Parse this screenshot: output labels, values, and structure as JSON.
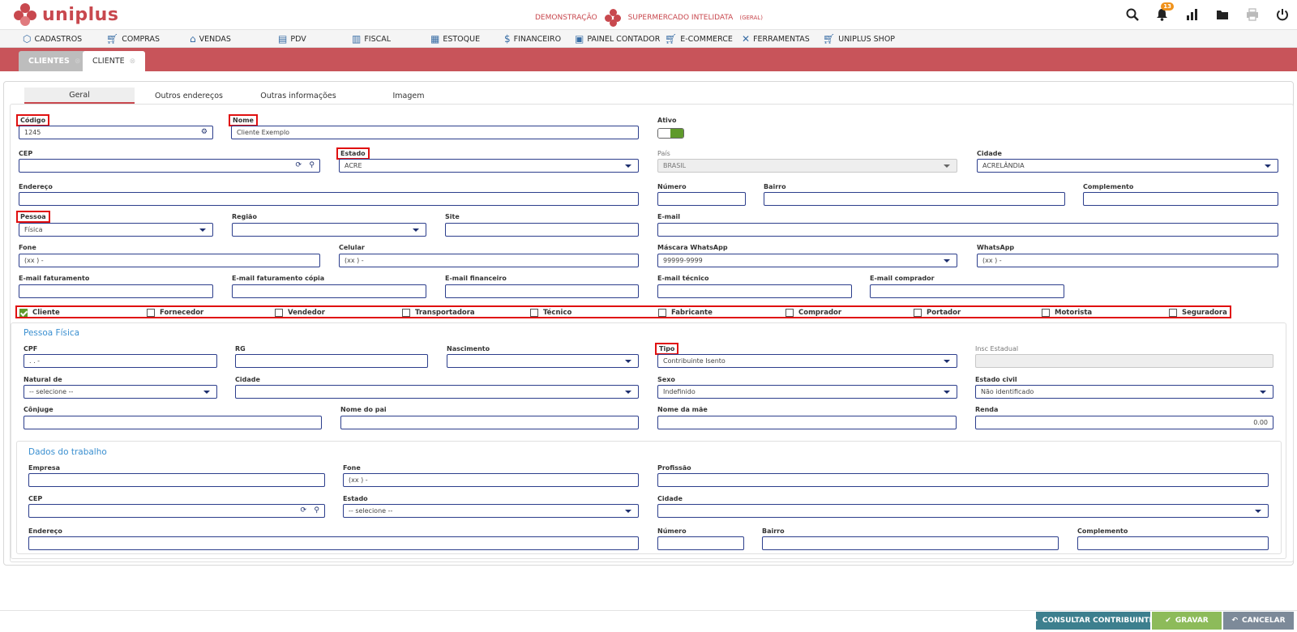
{
  "header": {
    "logo_text": "uniplus",
    "demo_label": "DEMONSTRAÇÃO",
    "company_name": "SUPERMERCADO INTELIDATA",
    "company_group": "(GERAL)",
    "notification_count": "13",
    "brand_color": "#c8484e",
    "icons": [
      "search-icon",
      "bell-icon",
      "chart-icon",
      "folder-icon",
      "printer-icon",
      "power-icon"
    ]
  },
  "menu": [
    {
      "label": "CADASTROS",
      "icon": "cube-icon"
    },
    {
      "label": "COMPRAS",
      "icon": "cart-icon"
    },
    {
      "label": "VENDAS",
      "icon": "tag-icon"
    },
    {
      "label": "PDV",
      "icon": "pos-icon"
    },
    {
      "label": "FISCAL",
      "icon": "document-icon"
    },
    {
      "label": "ESTOQUE",
      "icon": "box-icon"
    },
    {
      "label": "FINANCEIRO",
      "icon": "money-icon"
    },
    {
      "label": "PAINEL CONTADOR",
      "icon": "panel-icon"
    },
    {
      "label": "E-COMMERCE",
      "icon": "cart-icon"
    },
    {
      "label": "FERRAMENTAS",
      "icon": "tools-icon"
    },
    {
      "label": "UNIPLUS SHOP",
      "icon": "cart-icon"
    }
  ],
  "page_tabs": [
    {
      "label": "CLIENTES",
      "active": false
    },
    {
      "label": "CLIENTE",
      "active": true
    }
  ],
  "subtabs": [
    "Geral",
    "Outros endereços",
    "Outras informações",
    "Imagem"
  ],
  "general": {
    "codigo": {
      "label": "Código",
      "value": "1245"
    },
    "nome": {
      "label": "Nome",
      "value": "Cliente Exemplo"
    },
    "ativo": {
      "label": "Ativo",
      "value": true
    },
    "cep": {
      "label": "CEP",
      "value": ""
    },
    "estado": {
      "label": "Estado",
      "value": "ACRE"
    },
    "pais": {
      "label": "País",
      "value": "BRASIL"
    },
    "cidade": {
      "label": "Cidade",
      "value": "ACRELÂNDIA"
    },
    "endereco": {
      "label": "Endereço",
      "value": ""
    },
    "numero": {
      "label": "Número",
      "value": ""
    },
    "bairro": {
      "label": "Bairro",
      "value": ""
    },
    "complemento": {
      "label": "Complemento",
      "value": ""
    },
    "pessoa": {
      "label": "Pessoa",
      "value": "Física"
    },
    "regiao": {
      "label": "Região",
      "value": ""
    },
    "site": {
      "label": "Site",
      "value": ""
    },
    "email": {
      "label": "E-mail",
      "value": ""
    },
    "fone": {
      "label": "Fone",
      "value": "(xx )    -"
    },
    "celular": {
      "label": "Celular",
      "value": "(xx )    -"
    },
    "mascara_whatsapp": {
      "label": "Máscara WhatsApp",
      "value": "99999-9999"
    },
    "whatsapp": {
      "label": "WhatsApp",
      "value": "(xx )    -"
    },
    "email_faturamento": {
      "label": "E-mail faturamento",
      "value": ""
    },
    "email_faturamento_copia": {
      "label": "E-mail faturamento cópia",
      "value": ""
    },
    "email_financeiro": {
      "label": "E-mail financeiro",
      "value": ""
    },
    "email_tecnico": {
      "label": "E-mail técnico",
      "value": ""
    },
    "email_comprador": {
      "label": "E-mail comprador",
      "value": ""
    }
  },
  "roles": [
    {
      "label": "Cliente",
      "checked": true
    },
    {
      "label": "Fornecedor",
      "checked": false
    },
    {
      "label": "Vendedor",
      "checked": false
    },
    {
      "label": "Transportadora",
      "checked": false
    },
    {
      "label": "Técnico",
      "checked": false
    },
    {
      "label": "Fabricante",
      "checked": false
    },
    {
      "label": "Comprador",
      "checked": false
    },
    {
      "label": "Portador",
      "checked": false
    },
    {
      "label": "Motorista",
      "checked": false
    },
    {
      "label": "Seguradora",
      "checked": false
    }
  ],
  "pessoa_fisica": {
    "title": "Pessoa Física",
    "cpf": {
      "label": "CPF",
      "value": ".   .   -"
    },
    "rg": {
      "label": "RG",
      "value": ""
    },
    "nascimento": {
      "label": "Nascimento",
      "value": ""
    },
    "tipo": {
      "label": "Tipo",
      "value": "Contribuinte Isento"
    },
    "insc_estadual": {
      "label": "Insc Estadual",
      "value": ""
    },
    "natural_de": {
      "label": "Natural de",
      "value": "-- selecione --"
    },
    "cidade": {
      "label": "Cidade",
      "value": ""
    },
    "sexo": {
      "label": "Sexo",
      "value": "Indefinido"
    },
    "estado_civil": {
      "label": "Estado civil",
      "value": "Não identificado"
    },
    "conjuge": {
      "label": "Cônjuge",
      "value": ""
    },
    "nome_pai": {
      "label": "Nome do pai",
      "value": ""
    },
    "nome_mae": {
      "label": "Nome da mãe",
      "value": ""
    },
    "renda": {
      "label": "Renda",
      "value": "0.00"
    }
  },
  "trabalho": {
    "title": "Dados do trabalho",
    "empresa": {
      "label": "Empresa",
      "value": ""
    },
    "fone": {
      "label": "Fone",
      "value": "(xx )    -"
    },
    "profissao": {
      "label": "Profissão",
      "value": ""
    },
    "cep": {
      "label": "CEP",
      "value": ""
    },
    "estado": {
      "label": "Estado",
      "value": "-- selecione --"
    },
    "cidade": {
      "label": "Cidade",
      "value": ""
    },
    "endereco": {
      "label": "Endereço",
      "value": ""
    },
    "numero": {
      "label": "Número",
      "value": ""
    },
    "bairro": {
      "label": "Bairro",
      "value": ""
    },
    "complemento": {
      "label": "Complemento",
      "value": ""
    }
  },
  "actions": {
    "consultar": {
      "label": "CONSULTAR CONTRIBUINTE",
      "color": "#3d7f8e"
    },
    "gravar": {
      "label": "GRAVAR",
      "color": "#8dbb5a"
    },
    "cancelar": {
      "label": "CANCELAR",
      "color": "#7d8a99"
    }
  }
}
